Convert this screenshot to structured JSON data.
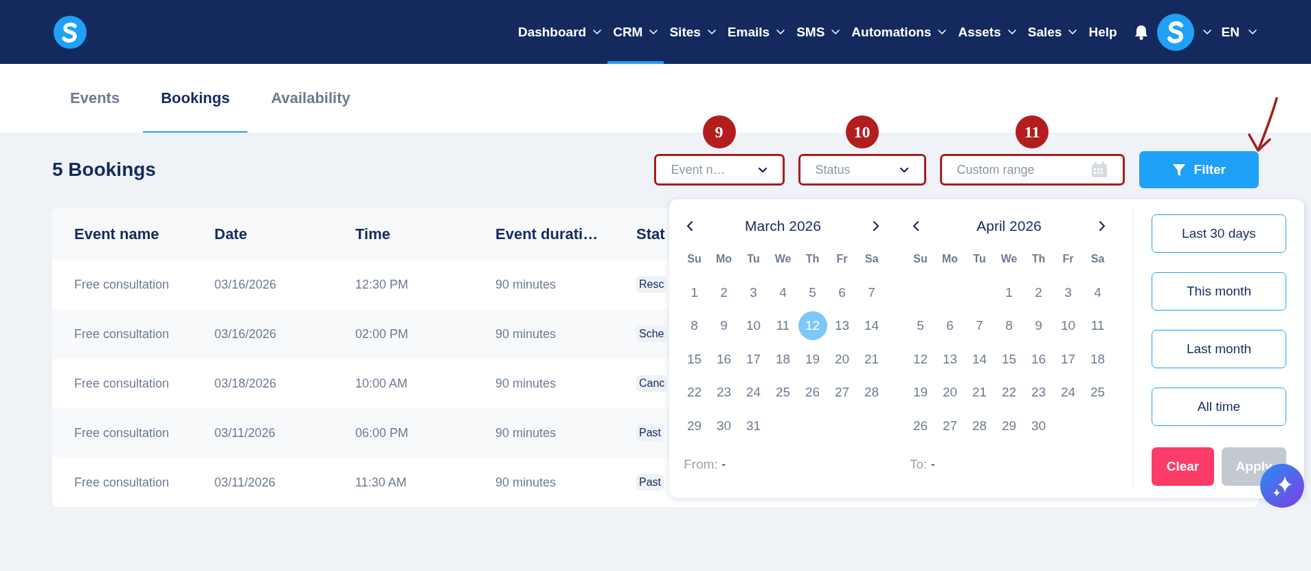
{
  "header": {
    "nav": [
      {
        "label": "Dashboard",
        "has_menu": true,
        "selected": false
      },
      {
        "label": "CRM",
        "has_menu": true,
        "selected": true
      },
      {
        "label": "Sites",
        "has_menu": true,
        "selected": false
      },
      {
        "label": "Emails",
        "has_menu": true,
        "selected": false
      },
      {
        "label": "SMS",
        "has_menu": true,
        "selected": false
      },
      {
        "label": "Automations",
        "has_menu": true,
        "selected": false
      },
      {
        "label": "Assets",
        "has_menu": true,
        "selected": false
      },
      {
        "label": "Sales",
        "has_menu": true,
        "selected": false
      },
      {
        "label": "Help",
        "has_menu": false,
        "selected": false
      }
    ],
    "language": "EN"
  },
  "tabs": [
    {
      "label": "Events",
      "selected": false
    },
    {
      "label": "Bookings",
      "selected": true
    },
    {
      "label": "Availability",
      "selected": false
    }
  ],
  "title": "5 Bookings",
  "filters": [
    {
      "kind": "select",
      "placeholder": "Event n…",
      "annotation": "9"
    },
    {
      "kind": "select",
      "placeholder": "Status",
      "annotation": "10"
    },
    {
      "kind": "date",
      "placeholder": "Custom range",
      "annotation": "11"
    }
  ],
  "filter_button": "Filter",
  "table": {
    "columns": [
      "Event name",
      "Date",
      "Time",
      "Event durati…",
      "Stat"
    ],
    "rows": [
      {
        "cells": [
          "Free consultation",
          "03/16/2026",
          "12:30 PM",
          "90 minutes"
        ],
        "status": "Resc"
      },
      {
        "cells": [
          "Free consultation",
          "03/16/2026",
          "02:00 PM",
          "90 minutes"
        ],
        "status": "Sche"
      },
      {
        "cells": [
          "Free consultation",
          "03/18/2026",
          "10:00 AM",
          "90 minutes"
        ],
        "status": "Canc"
      },
      {
        "cells": [
          "Free consultation",
          "03/11/2026",
          "06:00 PM",
          "90 minutes"
        ],
        "status": "Past"
      },
      {
        "cells": [
          "Free consultation",
          "03/11/2026",
          "11:30 AM",
          "90 minutes"
        ],
        "status": "Past"
      }
    ]
  },
  "date_picker": {
    "months": [
      {
        "title": "March 2026",
        "weekdays": [
          "Su",
          "Mo",
          "Tu",
          "We",
          "Th",
          "Fr",
          "Sa"
        ],
        "weeks": [
          [
            {
              "label": "1",
              "selected": false
            },
            {
              "label": "2",
              "selected": false
            },
            {
              "label": "3",
              "selected": false
            },
            {
              "label": "4",
              "selected": false
            },
            {
              "label": "5",
              "selected": false
            },
            {
              "label": "6",
              "selected": false
            },
            {
              "label": "7",
              "selected": false
            }
          ],
          [
            {
              "label": "8",
              "selected": false
            },
            {
              "label": "9",
              "selected": false
            },
            {
              "label": "10",
              "selected": false
            },
            {
              "label": "11",
              "selected": false
            },
            {
              "label": "12",
              "selected": true
            },
            {
              "label": "13",
              "selected": false
            },
            {
              "label": "14",
              "selected": false
            }
          ],
          [
            {
              "label": "15",
              "selected": false
            },
            {
              "label": "16",
              "selected": false
            },
            {
              "label": "17",
              "selected": false
            },
            {
              "label": "18",
              "selected": false
            },
            {
              "label": "19",
              "selected": false
            },
            {
              "label": "20",
              "selected": false
            },
            {
              "label": "21",
              "selected": false
            }
          ],
          [
            {
              "label": "22",
              "selected": false
            },
            {
              "label": "23",
              "selected": false
            },
            {
              "label": "24",
              "selected": false
            },
            {
              "label": "25",
              "selected": false
            },
            {
              "label": "26",
              "selected": false
            },
            {
              "label": "27",
              "selected": false
            },
            {
              "label": "28",
              "selected": false
            }
          ],
          [
            {
              "label": "29",
              "selected": false
            },
            {
              "label": "30",
              "selected": false
            },
            {
              "label": "31",
              "selected": false
            }
          ]
        ],
        "range_label": "From:",
        "range_value": "-"
      },
      {
        "title": "April 2026",
        "weekdays": [
          "Su",
          "Mo",
          "Tu",
          "We",
          "Th",
          "Fr",
          "Sa"
        ],
        "weeks": [
          [
            {
              "label": "1",
              "selected": false
            },
            {
              "label": "2",
              "selected": false
            },
            {
              "label": "3",
              "selected": false
            },
            {
              "label": "4",
              "selected": false
            }
          ],
          [
            {
              "label": "5",
              "selected": false
            },
            {
              "label": "6",
              "selected": false
            },
            {
              "label": "7",
              "selected": false
            },
            {
              "label": "8",
              "selected": false
            },
            {
              "label": "9",
              "selected": false
            },
            {
              "label": "10",
              "selected": false
            },
            {
              "label": "11",
              "selected": false
            }
          ],
          [
            {
              "label": "12",
              "selected": false
            },
            {
              "label": "13",
              "selected": false
            },
            {
              "label": "14",
              "selected": false
            },
            {
              "label": "15",
              "selected": false
            },
            {
              "label": "16",
              "selected": false
            },
            {
              "label": "17",
              "selected": false
            },
            {
              "label": "18",
              "selected": false
            }
          ],
          [
            {
              "label": "19",
              "selected": false
            },
            {
              "label": "20",
              "selected": false
            },
            {
              "label": "21",
              "selected": false
            },
            {
              "label": "22",
              "selected": false
            },
            {
              "label": "23",
              "selected": false
            },
            {
              "label": "24",
              "selected": false
            },
            {
              "label": "25",
              "selected": false
            }
          ],
          [
            {
              "label": "26",
              "selected": false
            },
            {
              "label": "27",
              "selected": false
            },
            {
              "label": "28",
              "selected": false
            },
            {
              "label": "29",
              "selected": false
            },
            {
              "label": "30",
              "selected": false
            }
          ]
        ],
        "range_label": "To:",
        "range_value": "-"
      }
    ],
    "presets": [
      "Last 30 days",
      "This month",
      "Last month",
      "All time"
    ],
    "actions": [
      {
        "label": "Clear",
        "kind": "danger",
        "disabled": false
      },
      {
        "label": "Apply",
        "kind": "primary",
        "disabled": true
      }
    ]
  }
}
